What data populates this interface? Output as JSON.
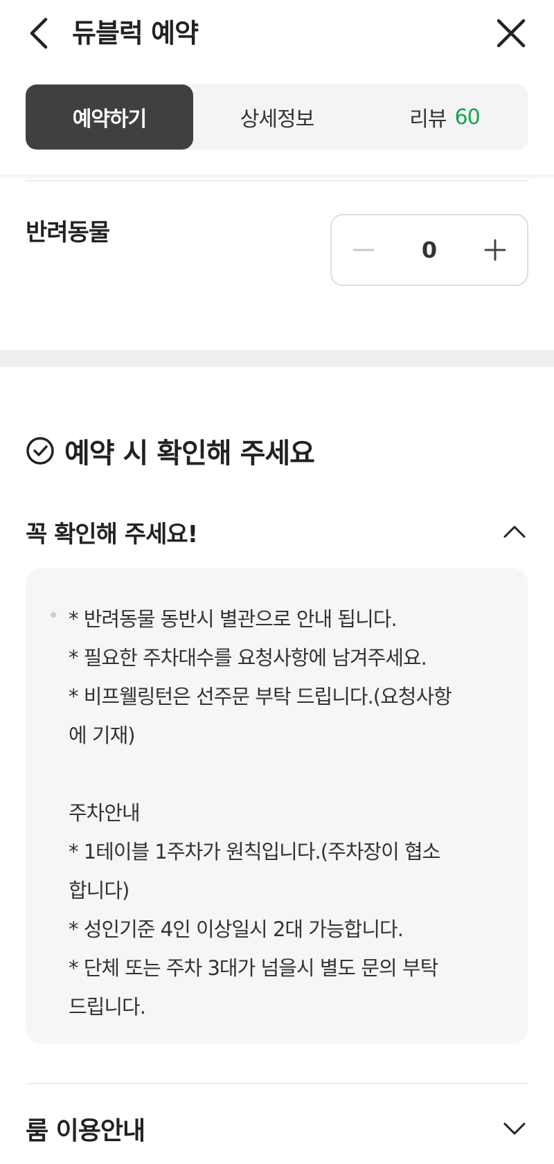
{
  "header": {
    "title": "듀블럭 예약",
    "back_icon": "chevron-left-icon",
    "close_icon": "close-icon"
  },
  "tabs": [
    {
      "label": "예약하기",
      "active": true
    },
    {
      "label": "상세정보",
      "active": false
    },
    {
      "label": "리뷰",
      "count": "60",
      "active": false
    }
  ],
  "pet": {
    "label": "반려동물",
    "value": "0",
    "minus_icon": "minus-icon",
    "plus_icon": "plus-icon"
  },
  "notice": {
    "heading": "예약 시 확인해 주세요",
    "must_check": {
      "title": "꼭 확인해 주세요!",
      "expanded": true,
      "body": "* 반려동물 동반시 별관으로 안내 됩니다.\n* 필요한 주차대수를 요청사항에 남겨주세요.\n* 비프웰링턴은 선주문 부탁 드립니다.(요청사항\n에 기재)\n\n주차안내\n* 1테이블 1주차가 원칙입니다.(주차장이 협소\n합니다)\n* 성인기준 4인 이상일시 2대 가능합니다.\n* 단체 또는 주차 3대가 넘을시 별도 문의 부탁\n드립니다."
    },
    "room_info": {
      "title": "룸 이용안내",
      "expanded": false
    }
  },
  "colors": {
    "active_tab_bg": "#404042",
    "review_count": "#14a34a",
    "notice_bg": "#f6f6f9"
  }
}
